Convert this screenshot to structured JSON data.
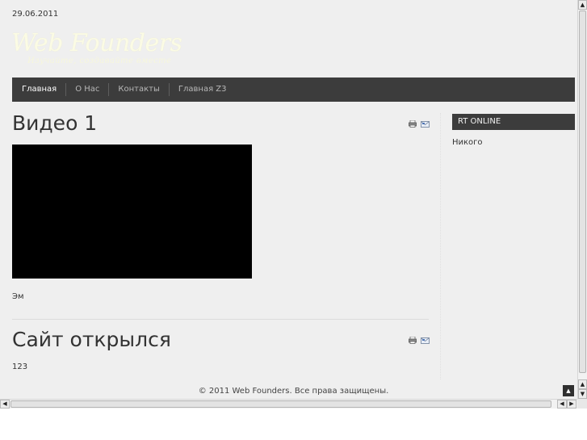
{
  "header": {
    "date": "29.06.2011",
    "site_name": "Web Founders",
    "tagline": "Изучайте, создавайте вместе"
  },
  "nav": {
    "items": [
      {
        "label": "Главная"
      },
      {
        "label": "О Нас"
      },
      {
        "label": "Контакты"
      },
      {
        "label": "Главная Z3"
      }
    ],
    "active_index": 0
  },
  "articles": [
    {
      "title": "Видео 1",
      "body": "Эм",
      "has_video": true
    },
    {
      "title": "Сайт открылся",
      "body": "123",
      "has_video": false
    }
  ],
  "article_icons": [
    "print-icon",
    "email-icon"
  ],
  "sidebar": {
    "module_title": "RT ONLINE",
    "module_text": "Никого"
  },
  "footer": {
    "copyright": "© 2011 Web Founders. Все права защищены."
  },
  "colors": {
    "page_bg": "#efefef",
    "nav_bg": "#3c3c3c",
    "logo": "#fbfbe4"
  }
}
